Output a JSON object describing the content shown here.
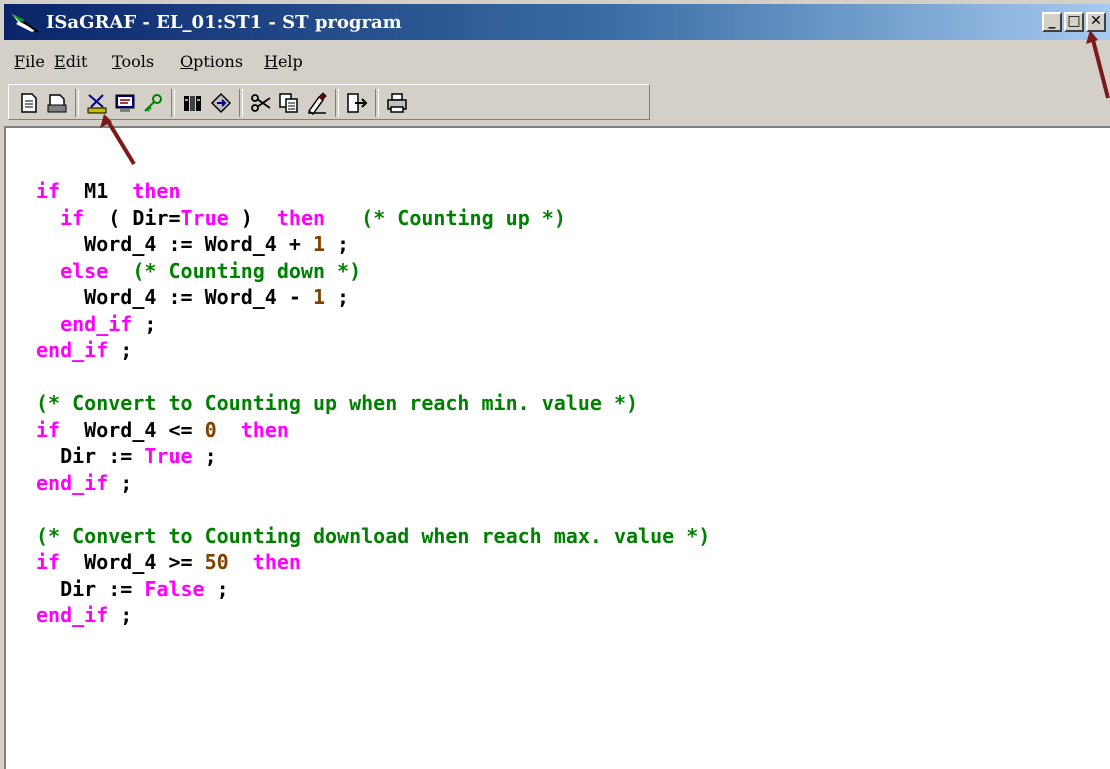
{
  "window": {
    "title": "ISaGRAF - EL_01:ST1 - ST program",
    "minimize": "_",
    "maximize": "□",
    "close": "✕"
  },
  "menu": [
    "File",
    "Edit",
    "Tools",
    "Options",
    "Help"
  ],
  "toolbar": {
    "groups": [
      [
        "new-document-icon",
        "open-document-icon"
      ],
      [
        "cut-variables-icon",
        "monitor-icon",
        "key-icon"
      ],
      [
        "library-icon",
        "compile-icon"
      ],
      [
        "scissors-icon",
        "copy-icon",
        "paste-icon"
      ],
      [
        "exit-icon"
      ],
      [
        "print-icon"
      ]
    ]
  },
  "code": [
    [
      {
        "t": "if",
        "c": "kw"
      },
      {
        "t": "  M1  ",
        "c": "nm"
      },
      {
        "t": "then",
        "c": "kw"
      }
    ],
    [
      {
        "t": "  ",
        "c": "nm"
      },
      {
        "t": "if",
        "c": "kw"
      },
      {
        "t": "  ( Dir=",
        "c": "nm"
      },
      {
        "t": "True",
        "c": "kw"
      },
      {
        "t": " )  ",
        "c": "nm"
      },
      {
        "t": "then",
        "c": "kw"
      },
      {
        "t": "   ",
        "c": "nm"
      },
      {
        "t": "(* Counting up *)",
        "c": "cm"
      }
    ],
    [
      {
        "t": "    Word_4 := Word_4 + ",
        "c": "nm"
      },
      {
        "t": "1",
        "c": "nu"
      },
      {
        "t": " ;",
        "c": "nm"
      }
    ],
    [
      {
        "t": "  ",
        "c": "nm"
      },
      {
        "t": "else",
        "c": "kw"
      },
      {
        "t": "  ",
        "c": "nm"
      },
      {
        "t": "(* Counting down *)",
        "c": "cm"
      }
    ],
    [
      {
        "t": "    Word_4 := Word_4 - ",
        "c": "nm"
      },
      {
        "t": "1",
        "c": "nu"
      },
      {
        "t": " ;",
        "c": "nm"
      }
    ],
    [
      {
        "t": "  ",
        "c": "nm"
      },
      {
        "t": "end_if",
        "c": "kw"
      },
      {
        "t": " ;",
        "c": "nm"
      }
    ],
    [
      {
        "t": "end_if",
        "c": "kw"
      },
      {
        "t": " ;",
        "c": "nm"
      }
    ],
    [],
    [
      {
        "t": "(* Convert to Counting up when reach min. value *)",
        "c": "cm"
      }
    ],
    [
      {
        "t": "if",
        "c": "kw"
      },
      {
        "t": "  Word_4 <= ",
        "c": "nm"
      },
      {
        "t": "0",
        "c": "nu"
      },
      {
        "t": "  ",
        "c": "nm"
      },
      {
        "t": "then",
        "c": "kw"
      }
    ],
    [
      {
        "t": "  Dir := ",
        "c": "nm"
      },
      {
        "t": "True",
        "c": "kw"
      },
      {
        "t": " ;",
        "c": "nm"
      }
    ],
    [
      {
        "t": "end_if",
        "c": "kw"
      },
      {
        "t": " ;",
        "c": "nm"
      }
    ],
    [],
    [
      {
        "t": "(* Convert to Counting download when reach max. value *)",
        "c": "cm"
      }
    ],
    [
      {
        "t": "if",
        "c": "kw"
      },
      {
        "t": "  Word_4 >= ",
        "c": "nm"
      },
      {
        "t": "50",
        "c": "nu"
      },
      {
        "t": "  ",
        "c": "nm"
      },
      {
        "t": "then",
        "c": "kw"
      }
    ],
    [
      {
        "t": "  Dir := ",
        "c": "nm"
      },
      {
        "t": "False",
        "c": "kw"
      },
      {
        "t": " ;",
        "c": "nm"
      }
    ],
    [
      {
        "t": "end_if",
        "c": "kw"
      },
      {
        "t": " ;",
        "c": "nm"
      }
    ]
  ],
  "colors": {
    "keyword": "#ff00ff",
    "comment": "#008000",
    "number": "#804000",
    "annotation_arrow": "#7a1a1a"
  }
}
